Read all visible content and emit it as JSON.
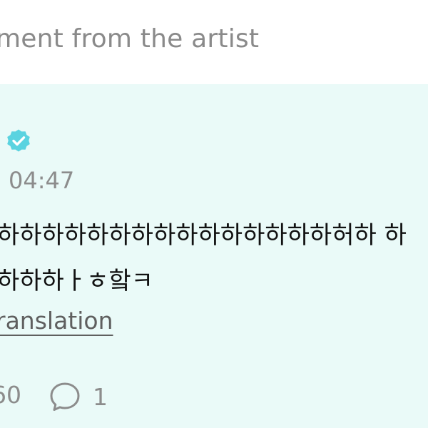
{
  "header": {
    "title": "ment from the artist"
  },
  "post": {
    "badge_icon": "verified-badge-icon",
    "time": "04:47",
    "message": "하하하하하하하하하하하하하하하허하 하\n하하하ㅏㅎ핰ㅋ",
    "translation_label": "ranslation"
  },
  "stats": {
    "like_count": "60",
    "comment_icon": "comment-bubble-icon",
    "comment_count": "1"
  },
  "colors": {
    "card_background": "#eafaf8",
    "badge": "#5ad3e0",
    "muted_text": "#8c8c8c"
  }
}
